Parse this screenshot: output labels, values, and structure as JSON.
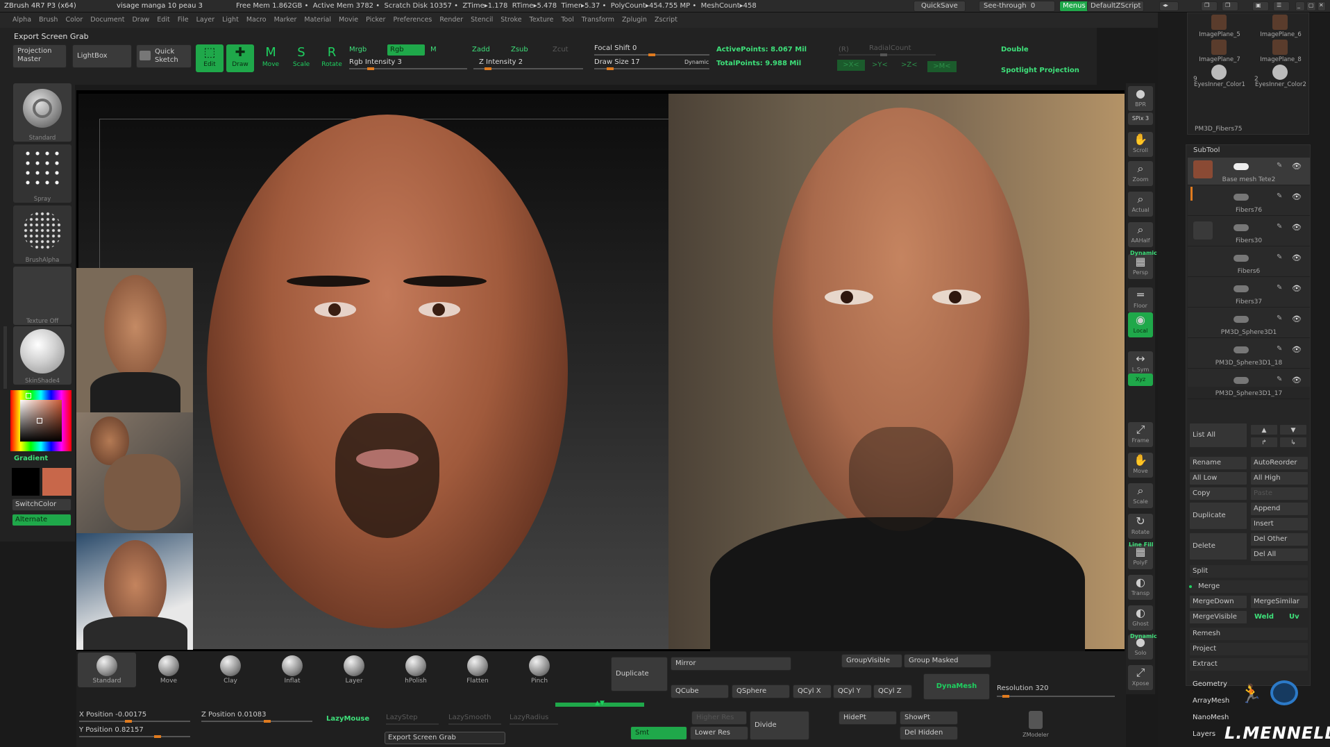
{
  "titlebar": {
    "app": "ZBrush 4R7 P3 (x64)",
    "doc": "visage manga 10 peau 3",
    "stats": [
      "Free Mem 1.862GB",
      "Active Mem 3782",
      "Scratch Disk 10357",
      "ZTime▸1.178",
      "RTime▸5.478",
      "Timer▸5.37",
      "PolyCount▸454.755 MP",
      "MeshCount▸458"
    ],
    "quicksave": "QuickSave",
    "see_through": "See-through",
    "see_through_value": "0",
    "menus": "Menus",
    "script": "DefaultZScript"
  },
  "menu": [
    "Alpha",
    "Brush",
    "Color",
    "Document",
    "Draw",
    "Edit",
    "File",
    "Layer",
    "Light",
    "Macro",
    "Marker",
    "Material",
    "Movie",
    "Picker",
    "Preferences",
    "Render",
    "Stencil",
    "Stroke",
    "Texture",
    "Tool",
    "Transform",
    "Zplugin",
    "Zscript"
  ],
  "shelf": {
    "export_title": "Export Screen Grab",
    "projection_master": "Projection Master",
    "lightbox": "LightBox",
    "quick_sketch": "Quick Sketch",
    "tools": [
      {
        "label": "Edit",
        "glyph": "⬚",
        "active": true
      },
      {
        "label": "Draw",
        "glyph": "✚",
        "active": true
      },
      {
        "label": "Move",
        "glyph": "M",
        "active": false
      },
      {
        "label": "Scale",
        "glyph": "S",
        "active": false
      },
      {
        "label": "Rotate",
        "glyph": "R",
        "active": false
      }
    ],
    "mrgb": "Mrgb",
    "rgb": "Rgb",
    "m": "M",
    "rgb_intensity": "Rgb Intensity 3",
    "zadd": "Zadd",
    "zsub": "Zsub",
    "zcut": "Zcut",
    "z_intensity": "Z Intensity 2",
    "focal_shift": "Focal Shift 0",
    "draw_size": "Draw Size 17",
    "dynamic": "Dynamic",
    "active_points": "ActivePoints: 8.067 Mil",
    "total_points": "TotalPoints: 9.988 Mil",
    "r_label": "(R)",
    "radial_count": "RadialCount",
    "sym_x": ">X<",
    "sym_y": ">Y<",
    "sym_z": ">Z<",
    "sym_m": ">M<",
    "double": "Double",
    "spotlight": "Spotlight Projection"
  },
  "left": {
    "brushes": [
      {
        "caption": "Standard"
      },
      {
        "caption": "Spray"
      },
      {
        "caption": "BrushAlpha"
      },
      {
        "caption": "Texture Off"
      },
      {
        "caption": "SkinShade4"
      }
    ],
    "gradient": "Gradient",
    "switch_color": "SwitchColor",
    "alternate": "Alternate",
    "main_color": "#c8674a",
    "secondary_color": "#000000"
  },
  "right_shelf": [
    {
      "label": "BPR",
      "glyph": "●"
    },
    {
      "label": "SPix 3",
      "glyph": ""
    },
    {
      "label": "Scroll",
      "glyph": "✋"
    },
    {
      "label": "Zoom",
      "glyph": "⌕"
    },
    {
      "label": "Actual",
      "glyph": "⌕"
    },
    {
      "label": "AAHalf",
      "glyph": "⌕"
    },
    {
      "label": "Persp",
      "glyph": "▦"
    },
    {
      "label": "Floor",
      "glyph": "═"
    },
    {
      "label": "Local",
      "glyph": "◉"
    },
    {
      "label": "L.Sym",
      "glyph": "↔"
    },
    {
      "label": "Xyz",
      "glyph": ""
    },
    {
      "label": "Frame",
      "glyph": "⤢"
    },
    {
      "label": "Move",
      "glyph": "✋"
    },
    {
      "label": "Scale",
      "glyph": "⌕"
    },
    {
      "label": "Rotate",
      "glyph": "↻"
    },
    {
      "label": "PolyF",
      "glyph": "▦"
    },
    {
      "label": "Transp",
      "glyph": "◐"
    },
    {
      "label": "Ghost",
      "glyph": "◐"
    },
    {
      "label": "Solo",
      "glyph": "●"
    },
    {
      "label": "Xpose",
      "glyph": "⤢"
    }
  ],
  "right_shelf_extra": {
    "dynamic": "Dynamic",
    "line_fill": "Line Fill",
    "dynamic2": "Dynamic"
  },
  "tray": {
    "top_items": [
      {
        "name": "ImagePlane_5"
      },
      {
        "name": "ImagePlane_6"
      },
      {
        "name": "ImagePlane_7"
      },
      {
        "name": "ImagePlane_8"
      },
      {
        "name": "EyesInner_Color1"
      },
      {
        "name": "EyesInner_Color2"
      }
    ],
    "count_left": "9",
    "count_right": "2",
    "fibers_top": "PM3D_Fibers75",
    "subtool_title": "SubTool",
    "subtools": [
      "Base mesh Tete2",
      "Fibers76",
      "Fibers30",
      "Fibers6",
      "Fibers37",
      "PM3D_Sphere3D1",
      "PM3D_Sphere3D1_18",
      "PM3D_Sphere3D1_17"
    ],
    "list_all": "List All",
    "rename": "Rename",
    "auto_reorder": "AutoReorder",
    "all_low": "All Low",
    "all_high": "All High",
    "copy": "Copy",
    "paste": "Paste",
    "duplicate": "Duplicate",
    "append": "Append",
    "insert": "Insert",
    "delete": "Delete",
    "del_other": "Del Other",
    "del_all": "Del All",
    "split": "Split",
    "merge": "Merge",
    "merge_down": "MergeDown",
    "merge_similar": "MergeSimilar",
    "merge_visible": "MergeVisible",
    "weld": "Weld",
    "uv": "Uv",
    "remesh": "Remesh",
    "project": "Project",
    "extract": "Extract",
    "geometry": "Geometry",
    "array_mesh": "ArrayMesh",
    "nano_mesh": "NanoMesh",
    "layers": "Layers",
    "signature": "L.MENNELLA"
  },
  "bottom": {
    "brushes": [
      "Standard",
      "Move",
      "Clay",
      "Inflat",
      "Layer",
      "hPolish",
      "Flatten",
      "Pinch"
    ],
    "x_position": "X Position -0.00175",
    "y_position": "Y Position 0.82157",
    "z_position": "Z Position 0.01083",
    "lazy_mouse": "LazyMouse",
    "lazy_step": "LazyStep",
    "lazy_smooth": "LazySmooth",
    "lazy_radius": "LazyRadius",
    "export": "Export Screen Grab",
    "duplicate": "Duplicate",
    "mirror": "Mirror",
    "qcube": "QCube",
    "qsphere": "QSphere",
    "qcylx": "QCyl X",
    "qcyly": "QCyl Y",
    "qcylz": "QCyl Z",
    "group_visible": "GroupVisible",
    "group_masked": "Group Masked",
    "dynamesh": "DynaMesh",
    "resolution": "Resolution 320",
    "higher_res": "Higher Res",
    "lower_res": "Lower Res",
    "smt": "Smt",
    "divide": "Divide",
    "hide_pt": "HidePt",
    "show_pt": "ShowPt",
    "del_hidden": "Del Hidden",
    "zmodeler": "ZModeler"
  }
}
